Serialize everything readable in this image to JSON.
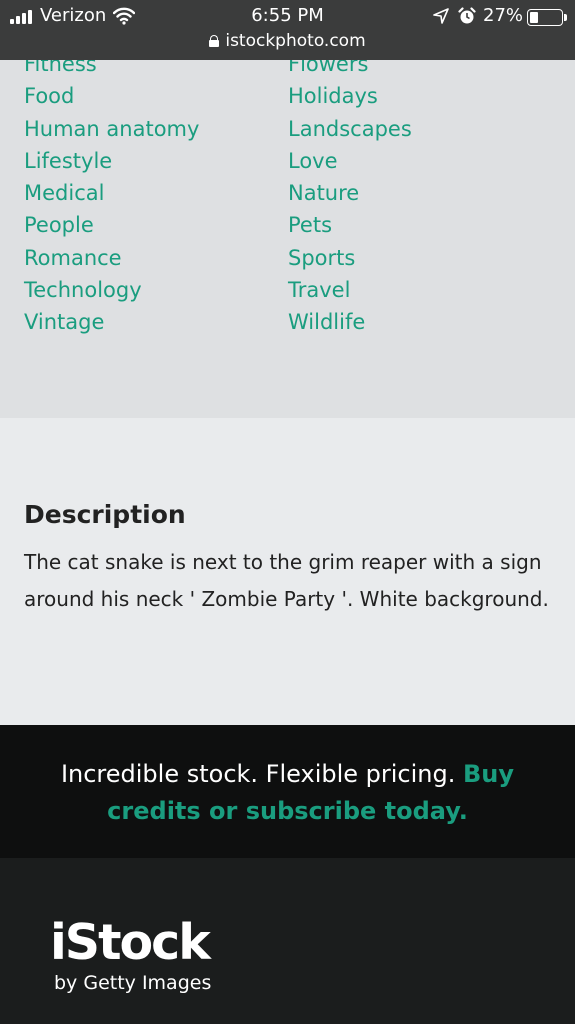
{
  "status_bar": {
    "carrier": "Verizon",
    "time": "6:55 PM",
    "battery_percent": "27%",
    "battery_level": 0.27,
    "url": "istockphoto.com",
    "icons": [
      "signal-icon",
      "wifi-icon",
      "location-icon",
      "alarm-icon",
      "battery-icon",
      "lock-icon"
    ]
  },
  "categories": {
    "left": [
      "Fitness",
      "Food",
      "Human anatomy",
      "Lifestyle",
      "Medical",
      "People",
      "Romance",
      "Technology",
      "Vintage"
    ],
    "right": [
      "Flowers",
      "Holidays",
      "Landscapes",
      "Love",
      "Nature",
      "Pets",
      "Sports",
      "Travel",
      "Wildlife"
    ]
  },
  "description": {
    "heading": "Description",
    "text": "The cat snake is next to the grim reaper with a sign around his neck ' Zombie Party '. White background."
  },
  "promo": {
    "text": "Incredible stock. Flexible pricing.",
    "link": "Buy credits or subscribe today."
  },
  "footer": {
    "logo": "iStock",
    "tagline": "by Getty Images"
  },
  "colors": {
    "accent": "#1a9d7f",
    "status_bar": "#3b3c3c",
    "categories_bg": "#dee0e2",
    "description_bg": "#e9ebed",
    "promo_bg": "#0e0f0f",
    "footer_bg": "#1b1d1d"
  }
}
